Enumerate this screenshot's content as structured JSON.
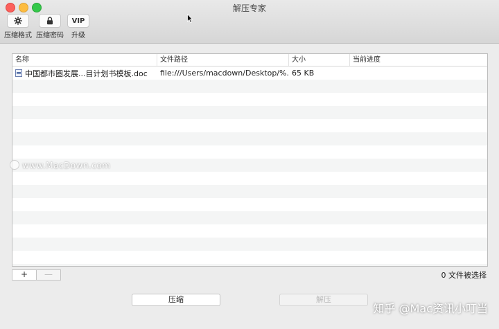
{
  "window": {
    "title": "解压专家"
  },
  "toolbar": {
    "items": [
      {
        "icon": "gear-icon",
        "glyph": "⚙",
        "label": "压缩格式"
      },
      {
        "icon": "lock-icon",
        "glyph": "🔒",
        "label": "压缩密码"
      },
      {
        "icon": "vip-badge",
        "glyph": "VIP",
        "label": "升级"
      }
    ]
  },
  "table": {
    "columns": [
      "名称",
      "文件路径",
      "大小",
      "当前进度"
    ],
    "rows": [
      {
        "name": "中国都市圈发展...目计划书模板.doc",
        "path": "file:///Users/macdown/Desktop/%...",
        "size": "65 KB",
        "progress": ""
      }
    ]
  },
  "footer": {
    "add_label": "+",
    "remove_label": "—",
    "selection_status": "0 文件被选择",
    "compress_label": "压缩",
    "extract_label": "解压"
  },
  "watermarks": {
    "left": "www.MacDown.com",
    "right": "知乎 @Mac资讯小叮当"
  }
}
